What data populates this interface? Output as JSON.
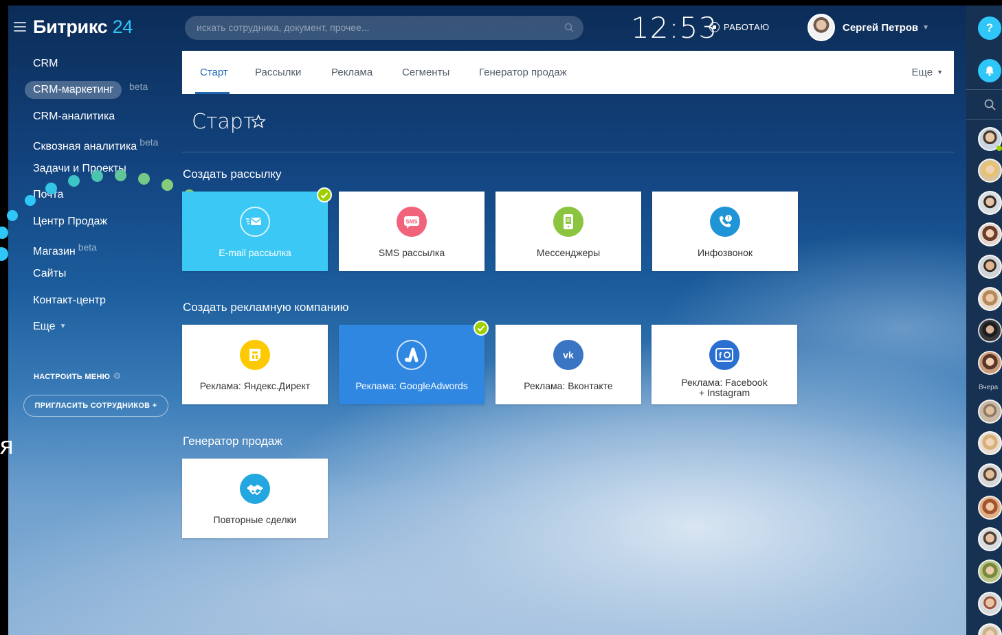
{
  "app": {
    "logo_text": "Битрикс",
    "logo_num": "24"
  },
  "sidebar": {
    "items": [
      {
        "label": "CRM",
        "beta": ""
      },
      {
        "label": "CRM-маркетинг",
        "beta": "beta"
      },
      {
        "label": "CRM-аналитика",
        "beta": ""
      },
      {
        "label": "Сквозная аналитика",
        "beta": "beta"
      },
      {
        "label": "Задачи и Проекты",
        "beta": ""
      },
      {
        "label": "Почта",
        "beta": ""
      },
      {
        "label": "Центр Продаж",
        "beta": ""
      },
      {
        "label": "Магазин",
        "beta": "beta"
      },
      {
        "label": "Сайты",
        "beta": ""
      },
      {
        "label": "Контакт-центр",
        "beta": ""
      },
      {
        "label": "Еще",
        "beta": ""
      }
    ],
    "active_index": 1,
    "configure_label": "НАСТРОИТЬ МЕНЮ",
    "invite_label": "ПРИГЛАСИТЬ СОТРУДНИКОВ +",
    "stray_glyph": "я"
  },
  "header": {
    "search_placeholder": "искать сотрудника, документ, прочее...",
    "clock": "12:53",
    "status": "РАБОТАЮ",
    "user_name": "Сергей Петров"
  },
  "tabs": {
    "items": [
      "Старт",
      "Рассылки",
      "Реклама",
      "Сегменты",
      "Генератор продаж"
    ],
    "active": "Старт",
    "more": "Еще"
  },
  "page": {
    "title": "Старт"
  },
  "sections": [
    {
      "title": "Создать рассылку",
      "tiles": [
        {
          "label": "E-mail рассылка",
          "icon": "email-icon",
          "color": "#3bc8f5",
          "selected": true
        },
        {
          "label": "SMS рассылка",
          "icon": "sms-icon",
          "color": "#f0637b",
          "selected": false
        },
        {
          "label": "Мессенджеры",
          "icon": "messenger-icon",
          "color": "#8bc53f",
          "selected": false
        },
        {
          "label": "Инфозвонок",
          "icon": "phone-icon",
          "color": "#1f95d8",
          "selected": false
        }
      ]
    },
    {
      "title": "Создать рекламную компанию",
      "tiles": [
        {
          "label": "Реклама: Яндекс.Директ",
          "icon": "yandex-direct-icon",
          "color": "#fdc900",
          "selected": false
        },
        {
          "label": "Реклама: GoogleAdwords",
          "icon": "google-adwords-icon",
          "color": "#2f87e2",
          "selected": true
        },
        {
          "label": "Реклама: Вконтакте",
          "icon": "vk-icon",
          "color": "#3a75c4",
          "selected": false
        },
        {
          "label_line1": "Реклама:  Facebook",
          "label_line2": "+ Instagram",
          "icon": "facebook-instagram-icon",
          "color": "#2b6fd1",
          "selected": false
        }
      ]
    },
    {
      "title": "Генератор продаж",
      "tiles": [
        {
          "label": "Повторные сделки",
          "icon": "handshake-icon",
          "color": "#24a7e0",
          "selected": false
        }
      ]
    }
  ],
  "right_panel": {
    "help_label": "?",
    "yesterday_label": "Вчера"
  },
  "colors": {
    "accent": "#2fc7f7",
    "tab_active": "#2067b0",
    "check": "#9dcf00"
  }
}
